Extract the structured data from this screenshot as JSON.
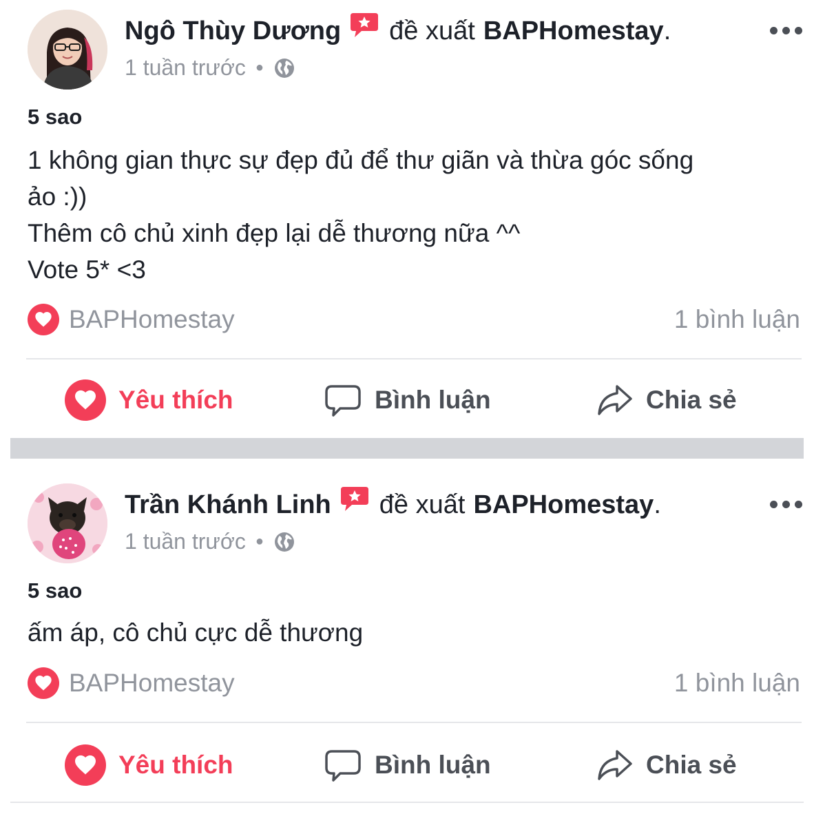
{
  "colors": {
    "accent_red": "#f33e58",
    "text_primary": "#1d2129",
    "text_secondary": "#90949c",
    "icon_gray": "#4b4f56",
    "separator": "#d3d5d9"
  },
  "posts": [
    {
      "author": "Ngô Thùy Dương",
      "recommend_icon": "recommendation-star-bubble-icon",
      "verb": "đề xuất",
      "page": "BAPHomestay",
      "page_suffix": ".",
      "time": "1 tuần trước",
      "privacy_icon": "globe-icon",
      "rating": "5 sao",
      "body_lines": [
        "1 không gian thực sự đẹp đủ để thư giãn và thừa góc sống",
        "ảo :))",
        "Thêm cô chủ xinh đẹp lại dễ thương nữa ^^",
        "Vote 5* <3"
      ],
      "reaction_name": "BAPHomestay",
      "comment_count": "1 bình luận",
      "actions": {
        "like": "Yêu thích",
        "comment": "Bình luận",
        "share": "Chia sẻ"
      }
    },
    {
      "author": "Trần Khánh Linh",
      "recommend_icon": "recommendation-star-bubble-icon",
      "verb": "đề xuất",
      "page": "BAPHomestay",
      "page_suffix": ".",
      "time": "1 tuần trước",
      "privacy_icon": "globe-icon",
      "rating": "5 sao",
      "body_lines": [
        "ấm áp, cô chủ cực dễ thương"
      ],
      "reaction_name": "BAPHomestay",
      "comment_count": "1 bình luận",
      "actions": {
        "like": "Yêu thích",
        "comment": "Bình luận",
        "share": "Chia sẻ"
      }
    }
  ]
}
